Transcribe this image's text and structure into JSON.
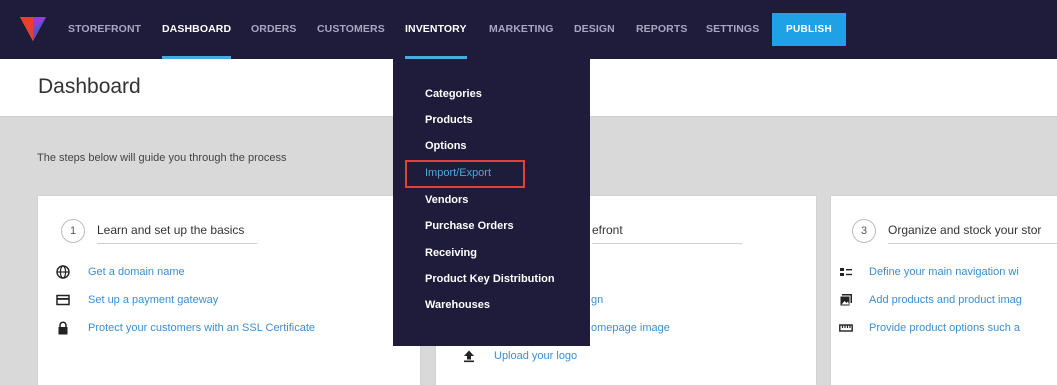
{
  "nav": {
    "items": [
      {
        "label": "STOREFRONT"
      },
      {
        "label": "DASHBOARD"
      },
      {
        "label": "ORDERS"
      },
      {
        "label": "CUSTOMERS"
      },
      {
        "label": "INVENTORY"
      },
      {
        "label": "MARKETING"
      },
      {
        "label": "DESIGN"
      },
      {
        "label": "REPORTS"
      },
      {
        "label": "SETTINGS"
      }
    ],
    "publish_label": "PUBLISH"
  },
  "page": {
    "title": "Dashboard",
    "guide_text": "The steps below will guide you through the process"
  },
  "cards": [
    {
      "number": "1",
      "title": "Learn and set up the basics",
      "links": [
        {
          "icon": "globe-icon",
          "label": "Get a domain name"
        },
        {
          "icon": "credit-card-icon",
          "label": "Set up a payment gateway"
        },
        {
          "icon": "lock-icon",
          "label": "Protect your customers with an SSL Certificate"
        }
      ]
    },
    {
      "title_fragment": "efront",
      "links": [
        {
          "label_fragment": "gn"
        },
        {
          "label_fragment": "omepage image"
        },
        {
          "icon": "upload-icon",
          "label": "Upload your logo"
        }
      ]
    },
    {
      "number": "3",
      "title": "Organize and stock your stor",
      "links": [
        {
          "icon": "navigation-icon",
          "label": "Define your main navigation wi"
        },
        {
          "icon": "image-icon",
          "label": "Add products and product imag"
        },
        {
          "icon": "ruler-icon",
          "label": "Provide product options such a"
        }
      ]
    }
  ],
  "dropdown": {
    "items": [
      {
        "label": "Categories"
      },
      {
        "label": "Products"
      },
      {
        "label": "Options"
      },
      {
        "label": "Import/Export"
      },
      {
        "label": "Vendors"
      },
      {
        "label": "Purchase Orders"
      },
      {
        "label": "Receiving"
      },
      {
        "label": "Product Key Distribution"
      },
      {
        "label": "Warehouses"
      }
    ]
  },
  "colors": {
    "nav_bg": "#1f1b3a",
    "accent": "#1fa1e6",
    "link": "#3a8fd4",
    "highlight_box": "#e0413a"
  }
}
